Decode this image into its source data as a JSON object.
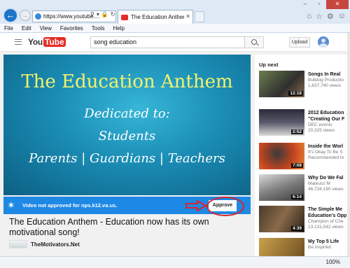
{
  "browser": {
    "address": "https://www.youtube....",
    "tab_title": "The Education Anthem - E...",
    "menu": [
      "File",
      "Edit",
      "View",
      "Favorites",
      "Tools",
      "Help"
    ],
    "zoom": "100%"
  },
  "youtube": {
    "logo_you": "You",
    "logo_tube": "Tube",
    "search_query": "song education",
    "upload_label": "Upload"
  },
  "player": {
    "title": "The Education Anthem",
    "lines": [
      "Dedicated to:",
      "Students",
      "Parents | Guardians | Teachers"
    ]
  },
  "notice": {
    "text": "Video not approved for nps.k12.va.us.",
    "approve_label": "Approve"
  },
  "video": {
    "title": "The Education Anthem - Education now has its own motivational song!",
    "channel": "TheMotivators.Net"
  },
  "sidebar": {
    "heading": "Up next",
    "items": [
      {
        "title": "Songs In Real",
        "sub1": "Bulldog Productio",
        "sub2": "1,637,740 views",
        "duration": "12:18"
      },
      {
        "title": "2012 Education",
        "sub1": "\"Creating Our F",
        "sub2": "DEC events",
        "sub3": "20,325 views",
        "duration": "2:52"
      },
      {
        "title": "Inside the Worl",
        "sub1": "It's Okay To Be S",
        "sub2": "Recommended fo",
        "duration": "7:08"
      },
      {
        "title": "Why Do We Fal",
        "sub1": "Mateusz M",
        "sub2": "46,734,190 views",
        "duration": "6:14"
      },
      {
        "title": "The Simple Me",
        "sub1": "Education's Opp",
        "sub2": "Champion of Che",
        "sub3": "13,131,542 views",
        "duration": "4:39"
      },
      {
        "title": "My Top 5 Life",
        "sub1": "Be Inspired",
        "duration": ""
      }
    ]
  }
}
